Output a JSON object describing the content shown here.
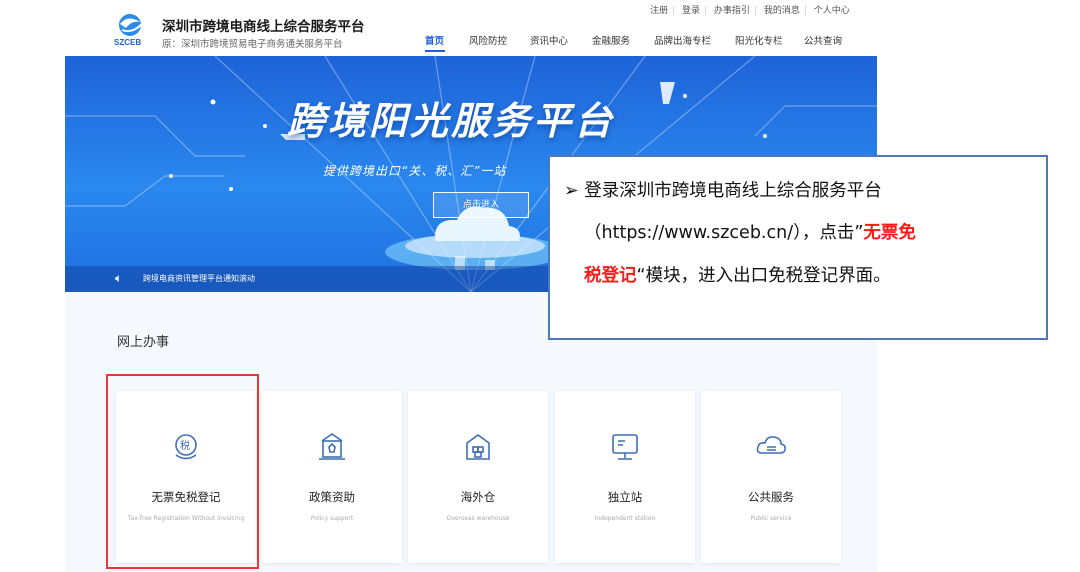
{
  "header": {
    "top_links": [
      "注册",
      "登录",
      "办事指引",
      "我的消息",
      "个人中心"
    ],
    "logo_text": "SZCEB",
    "site_title": "深圳市跨境电商线上综合服务平台",
    "site_subtitle": "原：深圳市跨境贸易电子商务通关服务平台",
    "nav": [
      "首页",
      "风险防控",
      "资讯中心",
      "金融服务",
      "品牌出海专栏",
      "阳光化专栏",
      "公共查询"
    ]
  },
  "banner": {
    "title": "跨境阳光服务平台",
    "subtitle": "提供跨境出口“关、税、汇”一站",
    "enter_label": "点击进入",
    "notice": "跨境电商资讯管理平台通知滚动"
  },
  "annotation": {
    "bullet": "➢",
    "line1": "登录深圳市跨境电商线上综合服务平台",
    "line2_prefix": "（https://www.szceb.cn/），点击”",
    "line2_highlight": "无票免",
    "line3_highlight": "税登记",
    "line3_suffix": "“模块，进入出口免税登记界面。"
  },
  "services": {
    "heading": "网上办事",
    "cards": [
      {
        "title": "无票免税登记",
        "subtitle": "Tax-free Registration Without Invoicing",
        "icon": "tax-icon"
      },
      {
        "title": "政策资助",
        "subtitle": "Policy support",
        "icon": "policy-icon"
      },
      {
        "title": "海外仓",
        "subtitle": "Overseas warehouse",
        "icon": "warehouse-icon"
      },
      {
        "title": "独立站",
        "subtitle": "Independent station",
        "icon": "station-icon"
      },
      {
        "title": "公共服务",
        "subtitle": "Public service",
        "icon": "public-service-icon"
      }
    ]
  },
  "colors": {
    "accent": "#1c5fd6",
    "highlight": "#e53935",
    "annotation_red": "#ff1a1a"
  }
}
